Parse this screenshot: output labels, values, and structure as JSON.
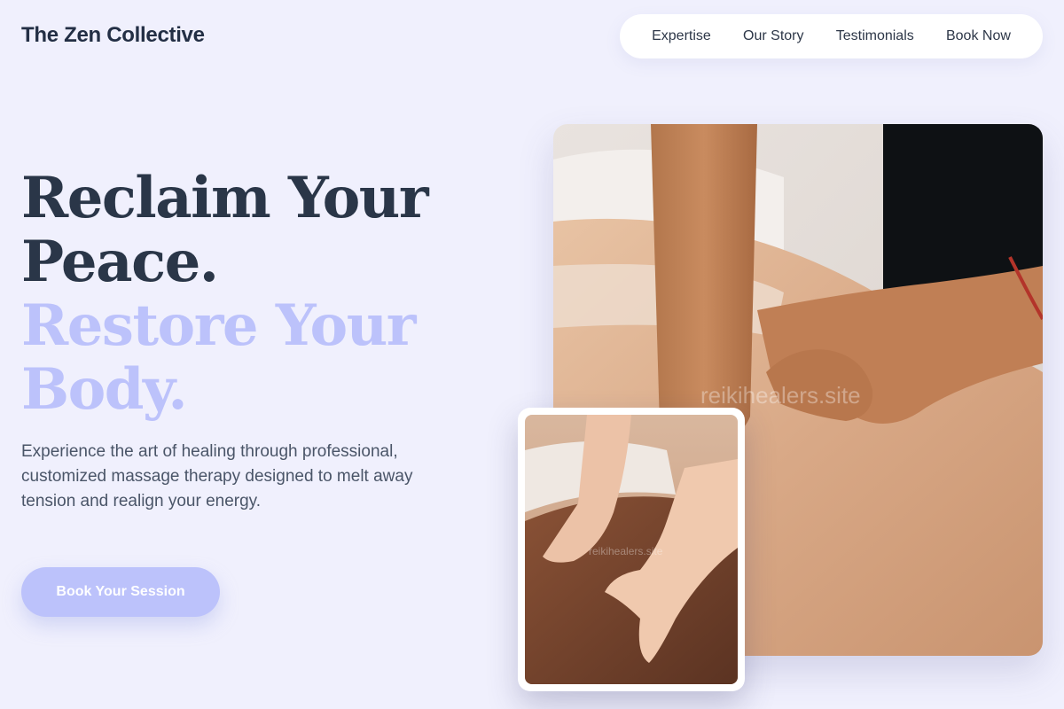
{
  "header": {
    "brand": "The Zen Collective",
    "nav": [
      "Expertise",
      "Our Story",
      "Testimonials",
      "Book Now"
    ]
  },
  "hero": {
    "title_line1": "Reclaim Your",
    "title_line2": "Peace.",
    "subtitle_line1": "Restore Your",
    "subtitle_line2": "Body.",
    "description": "Experience the art of healing through professional, customized massage therapy designed to melt away tension and realign your energy.",
    "cta_label": "Book Your Session"
  },
  "images": {
    "main_watermark": "reikihealers.site",
    "inset_watermark": "reikihealers.site"
  },
  "colors": {
    "background": "#f0f0fd",
    "accent": "#bcc2fb",
    "heading": "#2a3648"
  }
}
